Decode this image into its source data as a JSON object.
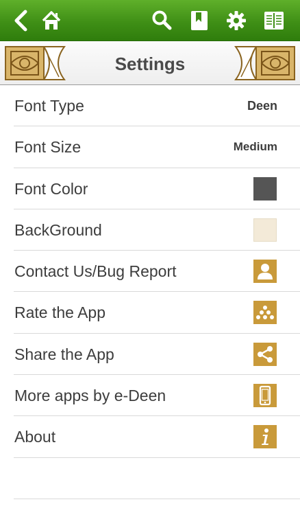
{
  "toolbar": {
    "icons": [
      "back-chevron-icon",
      "home-icon",
      "search-icon",
      "bookmark-icon",
      "gear-icon",
      "book-icon"
    ],
    "background": "#3f8f16"
  },
  "header": {
    "title": "Settings"
  },
  "settings": {
    "items": [
      {
        "label": "Font Type",
        "value": "Deen"
      },
      {
        "label": "Font Size",
        "value": "Medium"
      },
      {
        "label": "Font Color",
        "swatch_color": "#555555"
      },
      {
        "label": "BackGround",
        "swatch_color": "#f3ead8"
      },
      {
        "label": "Contact Us/Bug Report",
        "icon": "person-icon"
      },
      {
        "label": "Rate the App",
        "icon": "stars-icon"
      },
      {
        "label": "Share the App",
        "icon": "share-icon"
      },
      {
        "label": "More apps by e-Deen",
        "icon": "phone-icon"
      },
      {
        "label": "About",
        "icon": "info-icon"
      }
    ]
  },
  "colors": {
    "accent_gold": "#c99a3a",
    "toolbar_green": "#3f8f16",
    "text": "#3d3d3d"
  }
}
